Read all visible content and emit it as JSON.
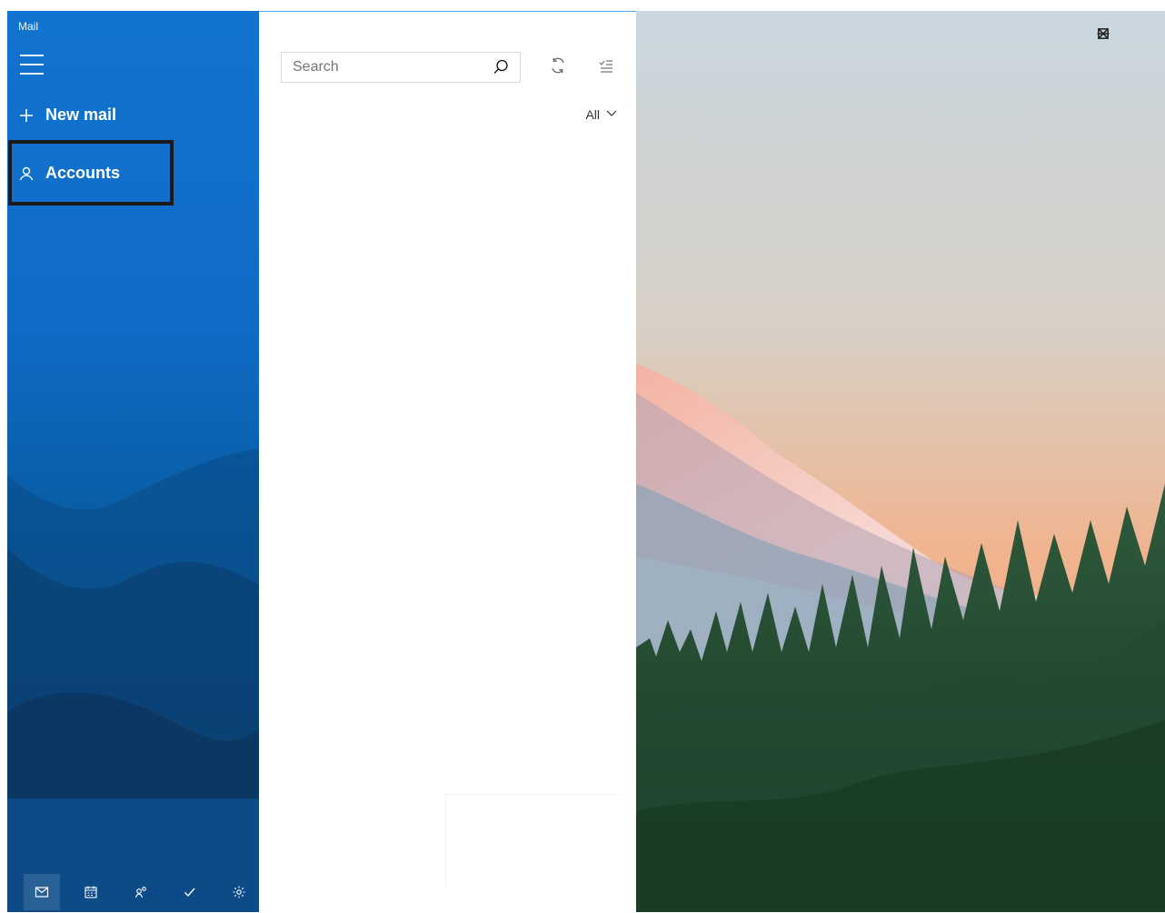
{
  "app": {
    "title": "Mail"
  },
  "nav": {
    "new_mail_label": "New mail",
    "accounts_label": "Accounts"
  },
  "search": {
    "placeholder": "Search"
  },
  "filter": {
    "label": "All"
  },
  "icons": {
    "hamburger": "hamburger-icon",
    "plus": "plus-icon",
    "person": "person-icon",
    "search": "search-icon",
    "sync": "sync-icon",
    "select": "select-mode-icon",
    "chevron": "chevron-down-icon",
    "mail": "mail-icon",
    "calendar": "calendar-icon",
    "people": "people-icon",
    "todo": "todo-icon",
    "settings": "settings-icon",
    "minimize": "minimize-icon",
    "maximize": "maximize-icon",
    "close": "close-icon"
  },
  "colors": {
    "accent": "#1174cf",
    "highlight_border": "#1a1a1a"
  }
}
